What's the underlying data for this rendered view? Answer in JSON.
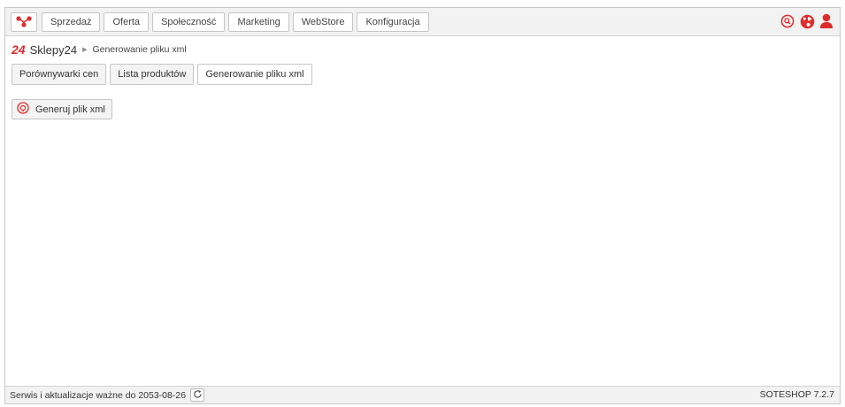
{
  "topbar": {
    "menu": [
      {
        "label": "Sprzedaż"
      },
      {
        "label": "Oferta"
      },
      {
        "label": "Społeczność"
      },
      {
        "label": "Marketing"
      },
      {
        "label": "WebStore"
      },
      {
        "label": "Konfiguracja"
      }
    ],
    "icons": [
      "app-logo-icon",
      "search-icon",
      "globe-icon",
      "user-icon"
    ]
  },
  "breadcrumb": {
    "logo": "24",
    "home": "Sklepy24",
    "current": "Generowanie pliku xml"
  },
  "tabs": [
    {
      "label": "Porównywarki cen",
      "active": false
    },
    {
      "label": "Lista produktów",
      "active": false
    },
    {
      "label": "Generowanie pliku xml",
      "active": true
    }
  ],
  "action": {
    "label": "Generuj plik xml",
    "icon": "generate-icon"
  },
  "footer": {
    "service_text": "Serwis i aktualizacje ważne do 2053-08-26",
    "version": "SOTESHOP 7.2.7"
  },
  "colors": {
    "accent": "#e02b2b",
    "bar_bg": "#f2f2f2",
    "border": "#c6c6c6"
  }
}
